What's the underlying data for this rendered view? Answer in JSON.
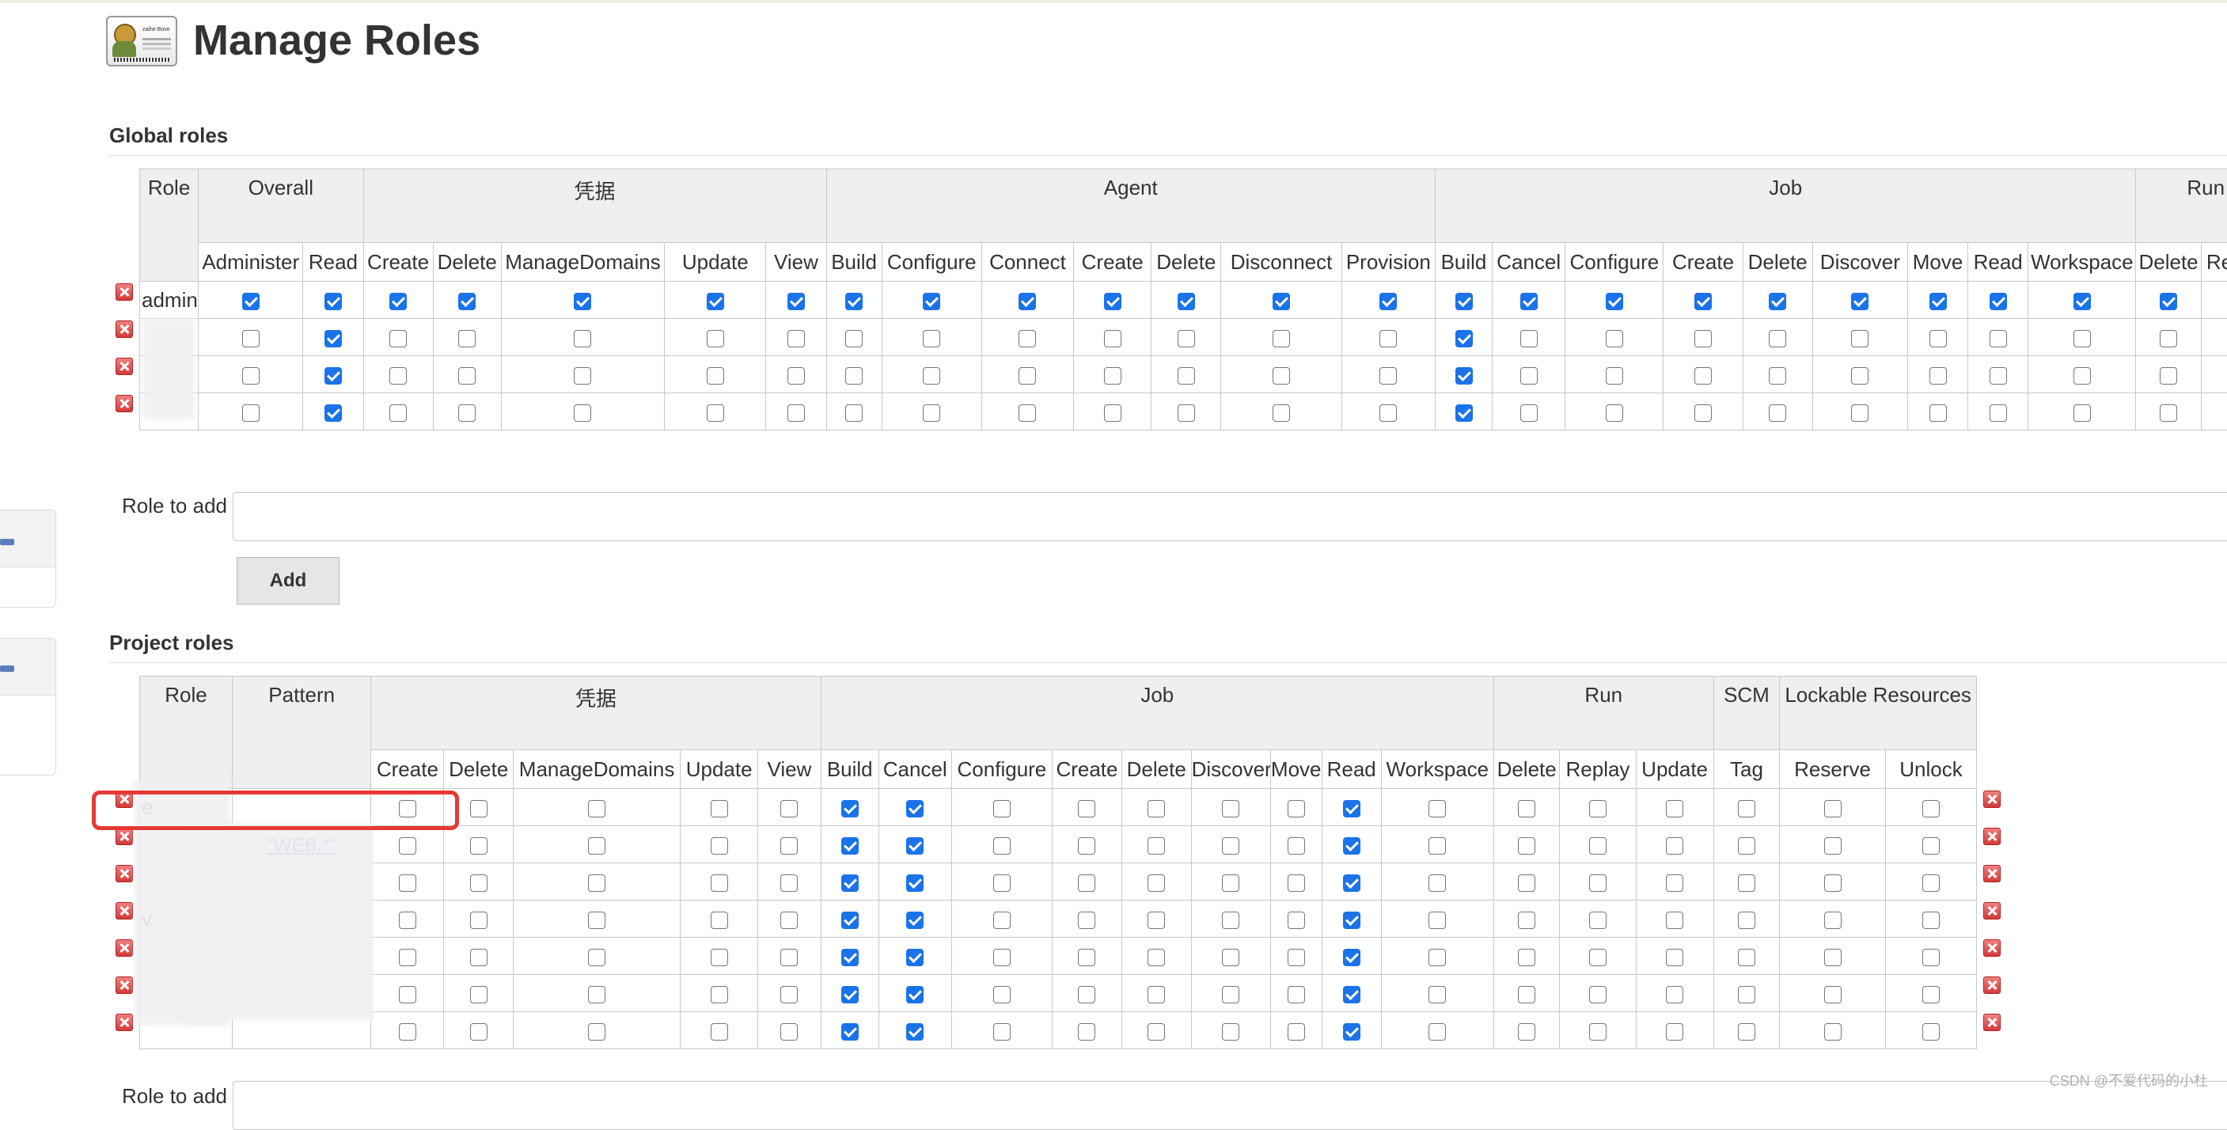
{
  "page": {
    "title": "Manage Roles"
  },
  "global": {
    "section_title": "Global roles",
    "role_header": "Role",
    "groups": [
      {
        "name": "Overall",
        "perms": [
          "Administer",
          "Read"
        ]
      },
      {
        "name": "凭据",
        "perms": [
          "Create",
          "Delete",
          "ManageDomains",
          "Update",
          "View"
        ]
      },
      {
        "name": "Agent",
        "perms": [
          "Build",
          "Configure",
          "Connect",
          "Create",
          "Delete",
          "Disconnect",
          "Provision"
        ]
      },
      {
        "name": "Job",
        "perms": [
          "Build",
          "Cancel",
          "Configure",
          "Create",
          "Delete",
          "Discover",
          "Move",
          "Read",
          "Workspace"
        ]
      },
      {
        "name": "Run",
        "perms": [
          "Delete",
          "Replay"
        ]
      }
    ],
    "rows": [
      {
        "name": "admin",
        "checks": [
          1,
          1,
          1,
          1,
          1,
          1,
          1,
          1,
          1,
          1,
          1,
          1,
          1,
          1,
          1,
          1,
          1,
          1,
          1,
          1,
          1,
          1,
          1,
          1,
          1
        ]
      },
      {
        "name": "",
        "checks": [
          0,
          1,
          0,
          0,
          0,
          0,
          0,
          0,
          0,
          0,
          0,
          0,
          0,
          0,
          1,
          0,
          0,
          0,
          0,
          0,
          0,
          0,
          0,
          0,
          0
        ]
      },
      {
        "name": "",
        "checks": [
          0,
          1,
          0,
          0,
          0,
          0,
          0,
          0,
          0,
          0,
          0,
          0,
          0,
          0,
          1,
          0,
          0,
          0,
          0,
          0,
          0,
          0,
          0,
          0,
          0
        ]
      },
      {
        "name": "",
        "checks": [
          0,
          1,
          0,
          0,
          0,
          0,
          0,
          0,
          0,
          0,
          0,
          0,
          0,
          0,
          1,
          0,
          0,
          0,
          0,
          0,
          0,
          0,
          0,
          0,
          0
        ]
      }
    ],
    "role_to_add_label": "Role to add",
    "role_to_add_value": "",
    "add_button": "Add"
  },
  "project": {
    "section_title": "Project roles",
    "role_header": "Role",
    "pattern_header": "Pattern",
    "groups": [
      {
        "name": "凭据",
        "perms": [
          "Create",
          "Delete",
          "ManageDomains",
          "Update",
          "View"
        ]
      },
      {
        "name": "Job",
        "perms": [
          "Build",
          "Cancel",
          "Configure",
          "Create",
          "Delete",
          "Discover",
          "Move",
          "Read",
          "Workspace"
        ]
      },
      {
        "name": "Run",
        "perms": [
          "Delete",
          "Replay",
          "Update"
        ]
      },
      {
        "name": "SCM",
        "perms": [
          "Tag"
        ]
      },
      {
        "name": "Lockable Resources",
        "perms": [
          "Reserve",
          "Unlock"
        ]
      }
    ],
    "rows": [
      {
        "name": "e",
        "pattern": "",
        "checks": [
          0,
          0,
          0,
          0,
          0,
          1,
          1,
          0,
          0,
          0,
          0,
          0,
          1,
          0,
          0,
          0,
          0,
          0,
          0,
          0
        ]
      },
      {
        "name": "",
        "pattern": "\"WEB.*\"",
        "checks": [
          0,
          0,
          0,
          0,
          0,
          1,
          1,
          0,
          0,
          0,
          0,
          0,
          1,
          0,
          0,
          0,
          0,
          0,
          0,
          0
        ]
      },
      {
        "name": "",
        "pattern": "",
        "checks": [
          0,
          0,
          0,
          0,
          0,
          1,
          1,
          0,
          0,
          0,
          0,
          0,
          1,
          0,
          0,
          0,
          0,
          0,
          0,
          0
        ]
      },
      {
        "name": "v",
        "pattern": "",
        "checks": [
          0,
          0,
          0,
          0,
          0,
          1,
          1,
          0,
          0,
          0,
          0,
          0,
          1,
          0,
          0,
          0,
          0,
          0,
          0,
          0
        ]
      },
      {
        "name": "",
        "pattern": "",
        "checks": [
          0,
          0,
          0,
          0,
          0,
          1,
          1,
          0,
          0,
          0,
          0,
          0,
          1,
          0,
          0,
          0,
          0,
          0,
          0,
          0
        ]
      },
      {
        "name": "",
        "pattern": "",
        "checks": [
          0,
          0,
          0,
          0,
          0,
          1,
          1,
          0,
          0,
          0,
          0,
          0,
          1,
          0,
          0,
          0,
          0,
          0,
          0,
          0
        ]
      },
      {
        "name": "",
        "pattern": "",
        "checks": [
          0,
          0,
          0,
          0,
          0,
          1,
          1,
          0,
          0,
          0,
          0,
          0,
          1,
          0,
          0,
          0,
          0,
          0,
          0,
          0
        ]
      }
    ],
    "role_to_add_label": "Role to add"
  },
  "logo": {
    "text": "zaihe Bove"
  },
  "watermark": "CSDN @不爱代码的小杜",
  "colors": {
    "checkbox_checked": "#1a73e8",
    "delete_icon": "#d23b3b",
    "highlight": "#e53935",
    "header_bg": "#efefef"
  }
}
